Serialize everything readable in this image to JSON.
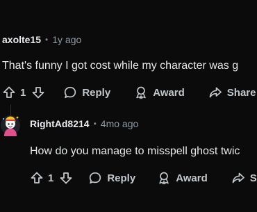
{
  "comments": [
    {
      "username": "axolte15",
      "age": "1y ago",
      "body": "That's funny I got cost while my character was g",
      "upvotes": "1",
      "reply_label": "Reply",
      "award_label": "Award",
      "share_label": "Share"
    },
    {
      "username": "RightAd8214",
      "age": "4mo ago",
      "body": "How do you manage to misspell ghost twic",
      "upvotes": "1",
      "reply_label": "Reply",
      "award_label": "Award",
      "share_label": "S"
    }
  ],
  "separator": "•",
  "colors": {
    "background": "#0b0b0b",
    "text": "#e6e8ea",
    "muted": "#8f9aa3"
  },
  "icons": [
    "upvote-icon",
    "downvote-icon",
    "reply-bubble-icon",
    "award-icon",
    "share-icon"
  ]
}
